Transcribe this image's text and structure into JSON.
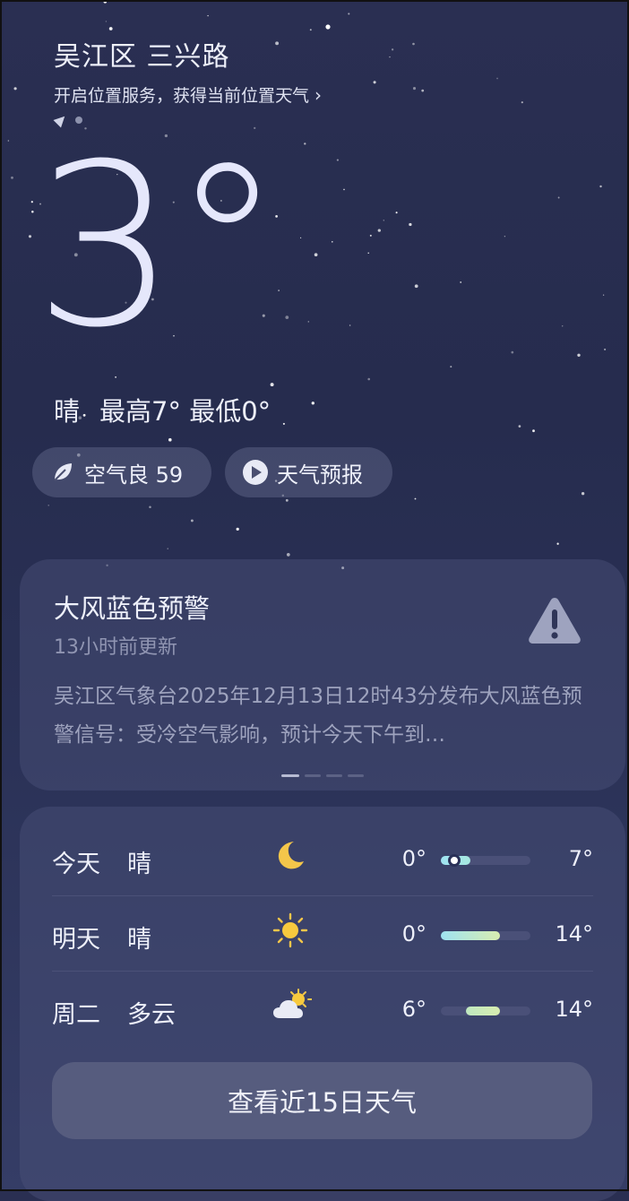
{
  "header": {
    "location": "吴江区 三兴路",
    "location_tip": "开启位置服务，获得当前位置天气",
    "tip_chevron": "›"
  },
  "current": {
    "temperature": "3°",
    "condition": "晴",
    "high": "最高7°",
    "low": "最低0°"
  },
  "chips": {
    "aqi_label": "空气良 59",
    "forecast_label": "天气预报"
  },
  "alert": {
    "title": "大风蓝色预警",
    "updated": "13小时前更新",
    "body": "吴江区气象台2025年12月13日12时43分发布大风蓝色预警信号：受冷空气影响，预计今天下午到…",
    "page_count": 4,
    "active_page": 1
  },
  "forecast": [
    {
      "day": "今天",
      "condition": "晴",
      "icon": "moon-icon",
      "low": "0°",
      "high": "7°",
      "range_start": 0.0,
      "range_end": 0.33,
      "current": 0.15
    },
    {
      "day": "明天",
      "condition": "晴",
      "icon": "sun-icon",
      "low": "0°",
      "high": "14°",
      "range_start": 0.0,
      "range_end": 0.66
    },
    {
      "day": "周二",
      "condition": "多云",
      "icon": "partly-cloudy-icon",
      "low": "6°",
      "high": "14°",
      "range_start": 0.28,
      "range_end": 0.66
    }
  ],
  "more_button": "查看近15日天气",
  "colors": {
    "sky_top": "#2a2f52",
    "card": "#4b527a",
    "bar_cool": "#9fe3f2",
    "bar_warm": "#d8edb0"
  }
}
